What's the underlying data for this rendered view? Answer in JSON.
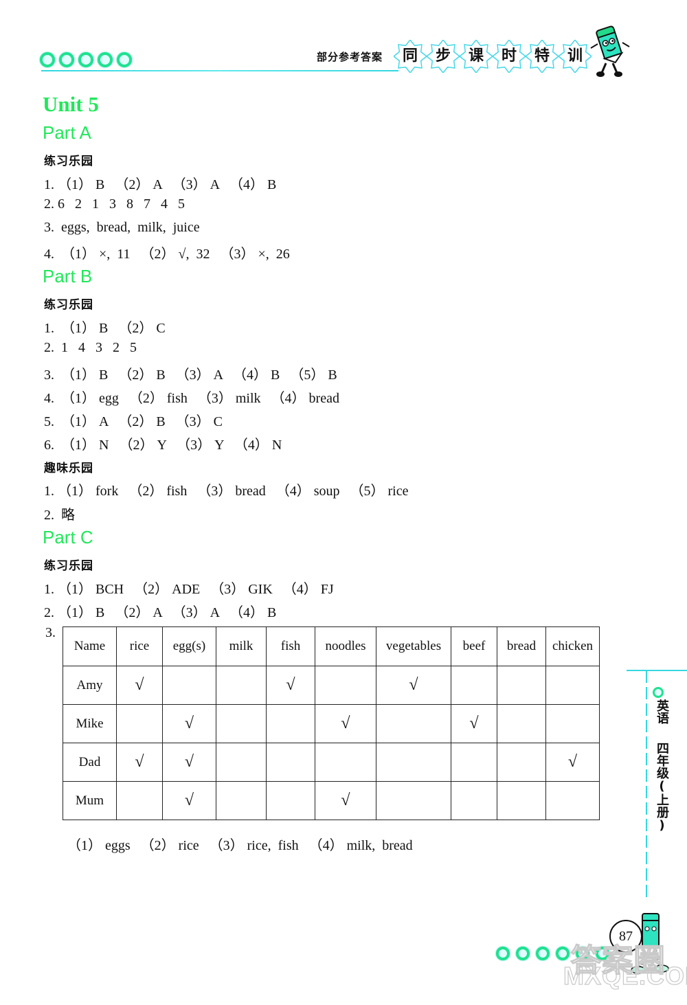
{
  "header": {
    "caption": "部分参考答案",
    "series_title_chars": [
      "同",
      "步",
      "课",
      "时",
      "特",
      "训"
    ],
    "dot_count": 5
  },
  "unit": {
    "title": "Unit  5"
  },
  "partA": {
    "title": "Part  A",
    "section": "练习乐园",
    "lines": [
      "1. （1） B   （2） A   （3） A   （4） B",
      "2. 6   2   1   3   8   7   4   5",
      "3.  eggs,  bread,  milk,  juice",
      "4.  （1） ×,  11   （2） √,  32   （3） ×,  26"
    ]
  },
  "partB": {
    "title": "Part  B",
    "section": "练习乐园",
    "lines": [
      "1.  （1） B   （2） C",
      "2.  1   4   3   2   5",
      "3.  （1） B   （2） B   （3） A   （4） B   （5） B",
      "4.  （1） egg   （2） fish   （3） milk   （4） bread",
      "5.  （1） A   （2） B   （3） C",
      "6.  （1） N   （2） Y   （3） Y   （4） N"
    ],
    "section2": "趣味乐园",
    "lines2": [
      "1. （1） fork   （2） fish   （3） bread   （4） soup   （5） rice",
      "2.  略"
    ]
  },
  "partC": {
    "title": "Part  C",
    "section": "练习乐园",
    "lines": [
      "1. （1） BCH   （2） ADE   （3） GIK   （4） FJ",
      "2. （1） B   （2） A   （3） A   （4） B"
    ],
    "q3_label": "3.",
    "table": {
      "headers": [
        "Name",
        "rice",
        "egg(s)",
        "milk",
        "fish",
        "noodles",
        "vegetables",
        "beef",
        "bread",
        "chicken"
      ],
      "check_mark": "√",
      "rows": [
        {
          "name": "Amy",
          "cells": [
            "√",
            "",
            "",
            "√",
            "",
            "√",
            "",
            "",
            ""
          ]
        },
        {
          "name": "Mike",
          "cells": [
            "",
            "√",
            "",
            "",
            "√",
            "",
            "√",
            "",
            ""
          ]
        },
        {
          "name": "Dad",
          "cells": [
            "√",
            "√",
            "",
            "",
            "",
            "",
            "",
            "",
            "√"
          ]
        },
        {
          "name": "Mum",
          "cells": [
            "",
            "√",
            "",
            "",
            "√",
            "",
            "",
            "",
            ""
          ]
        }
      ]
    },
    "answers": "（1） eggs   （2） rice   （3） rice,  fish   （4） milk,  bread"
  },
  "side_tab": {
    "subject": "英语",
    "grade": "四年级(上册)"
  },
  "footer": {
    "page_number": "87",
    "dot_count": 6,
    "watermark_top": "答案圈",
    "watermark_bottom": "MXQE.COM"
  },
  "colors": {
    "heading_green": "#21e85a",
    "accent_cyan": "#35d8e0",
    "dot_green": "#1fe28f"
  }
}
